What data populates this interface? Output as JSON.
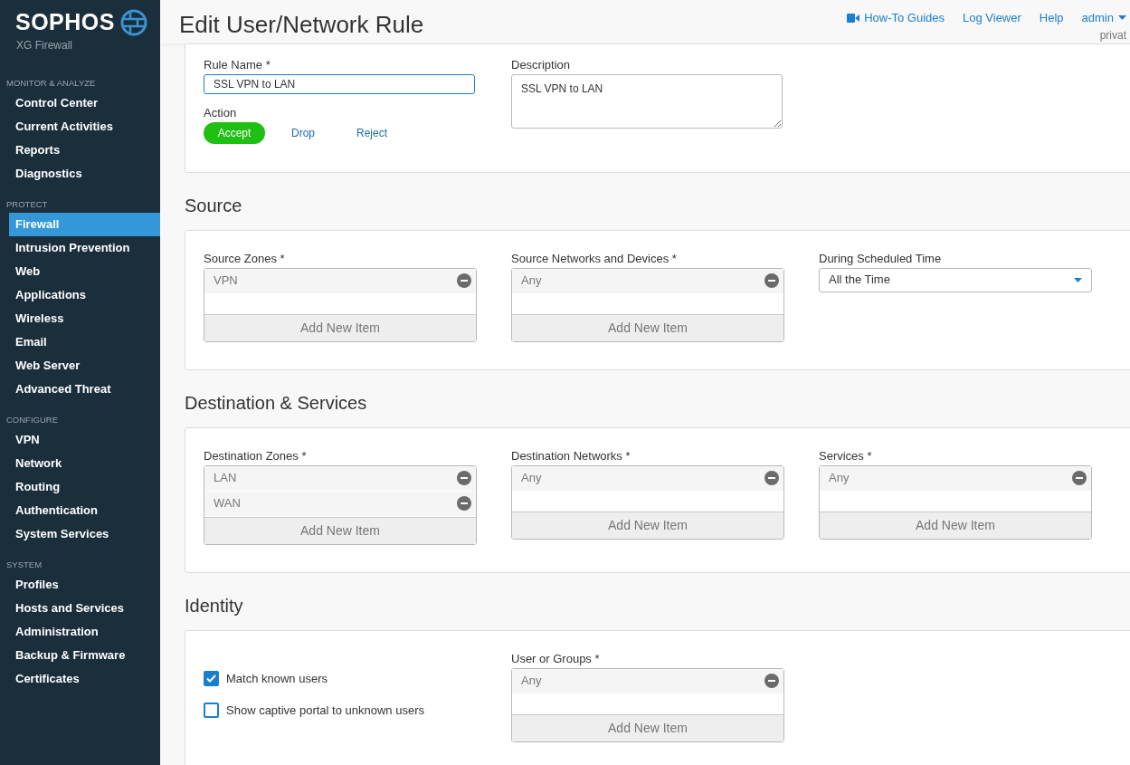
{
  "brand": {
    "name": "SOPHOS",
    "product": "XG Firewall"
  },
  "sidebar": [
    {
      "heading": "MONITOR & ANALYZE",
      "items": [
        {
          "label": "Control Center",
          "selected": false
        },
        {
          "label": "Current Activities",
          "selected": false
        },
        {
          "label": "Reports",
          "selected": false
        },
        {
          "label": "Diagnostics",
          "selected": false
        }
      ]
    },
    {
      "heading": "PROTECT",
      "items": [
        {
          "label": "Firewall",
          "selected": true
        },
        {
          "label": "Intrusion Prevention",
          "selected": false
        },
        {
          "label": "Web",
          "selected": false
        },
        {
          "label": "Applications",
          "selected": false
        },
        {
          "label": "Wireless",
          "selected": false
        },
        {
          "label": "Email",
          "selected": false
        },
        {
          "label": "Web Server",
          "selected": false
        },
        {
          "label": "Advanced Threat",
          "selected": false
        }
      ]
    },
    {
      "heading": "CONFIGURE",
      "items": [
        {
          "label": "VPN",
          "selected": false
        },
        {
          "label": "Network",
          "selected": false
        },
        {
          "label": "Routing",
          "selected": false
        },
        {
          "label": "Authentication",
          "selected": false
        },
        {
          "label": "System Services",
          "selected": false
        }
      ]
    },
    {
      "heading": "SYSTEM",
      "items": [
        {
          "label": "Profiles",
          "selected": false
        },
        {
          "label": "Hosts and Services",
          "selected": false
        },
        {
          "label": "Administration",
          "selected": false
        },
        {
          "label": "Backup & Firmware",
          "selected": false
        },
        {
          "label": "Certificates",
          "selected": false
        }
      ]
    }
  ],
  "page_title": "Edit User/Network Rule",
  "top_links": [
    {
      "label": "How-To Guides",
      "kind": "video"
    },
    {
      "label": "Log Viewer",
      "kind": "plain"
    },
    {
      "label": "Help",
      "kind": "plain"
    },
    {
      "label": "admin",
      "kind": "menu"
    }
  ],
  "user_sub": "privat",
  "rule": {
    "name_label": "Rule Name *",
    "name_value": "SSL VPN to LAN",
    "description_label": "Description",
    "description_value": "SSL VPN to LAN",
    "action_label": "Action",
    "actions": [
      {
        "label": "Accept",
        "selected": true
      },
      {
        "label": "Drop",
        "selected": false
      },
      {
        "label": "Reject",
        "selected": false
      }
    ]
  },
  "sections": [
    {
      "title": "Source",
      "fields": [
        {
          "kind": "list",
          "label": "Source Zones *",
          "items": [
            "VPN"
          ],
          "add": "Add New Item"
        },
        {
          "kind": "list",
          "label": "Source Networks and Devices *",
          "items": [
            "Any"
          ],
          "add": "Add New Item"
        },
        {
          "kind": "select",
          "label": "During Scheduled Time",
          "value": "All the Time"
        }
      ]
    },
    {
      "title": "Destination & Services",
      "fields": [
        {
          "kind": "list",
          "label": "Destination Zones *",
          "items": [
            "LAN",
            "WAN"
          ],
          "add": "Add New Item"
        },
        {
          "kind": "list",
          "label": "Destination Networks *",
          "items": [
            "Any"
          ],
          "add": "Add New Item"
        },
        {
          "kind": "list",
          "label": "Services *",
          "items": [
            "Any"
          ],
          "add": "Add New Item"
        }
      ]
    },
    {
      "title": "Identity",
      "fields": [
        {
          "kind": "checks",
          "checks": [
            {
              "label": "Match known users",
              "checked": true
            },
            {
              "label": "Show captive portal to unknown users",
              "checked": false
            }
          ]
        },
        {
          "kind": "list",
          "label": "User or Groups *",
          "items": [
            "Any"
          ],
          "add": "Add New Item"
        }
      ]
    }
  ]
}
